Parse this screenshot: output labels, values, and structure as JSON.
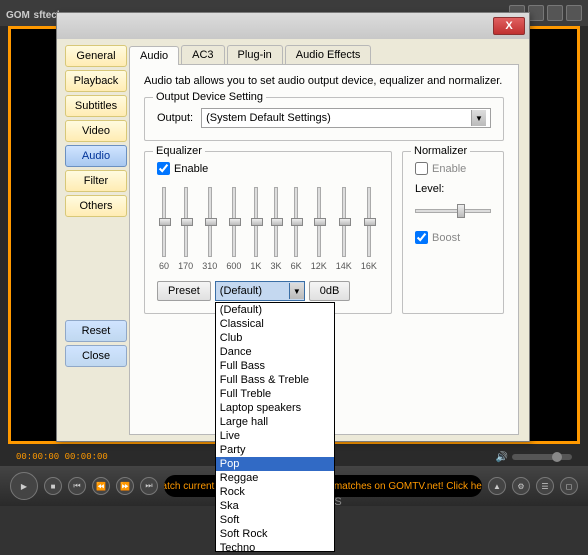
{
  "player": {
    "logo": "GOM",
    "logo_sub": "sftechs.com",
    "timecode": "00:00:00  00:00:00",
    "ticker": "Watch current Global Starcraft II League matches on GOMTV.net! Click here!",
    "preferences_label": "PREFERENCES"
  },
  "dialog": {
    "sidebar": {
      "items": [
        "General",
        "Playback",
        "Subtitles",
        "Video",
        "Audio",
        "Filter",
        "Others"
      ],
      "active_index": 4,
      "reset": "Reset",
      "close": "Close"
    },
    "tabs": [
      "Audio",
      "AC3",
      "Plug-in",
      "Audio Effects"
    ],
    "active_tab": 0,
    "hint": "Audio tab allows you to set audio output device, equalizer and normalizer.",
    "output": {
      "legend": "Output Device Setting",
      "label": "Output:",
      "value": "(System Default Settings)"
    },
    "equalizer": {
      "legend": "Equalizer",
      "enable": "Enable",
      "enable_checked": true,
      "bands": [
        "60",
        "170",
        "310",
        "600",
        "1K",
        "3K",
        "6K",
        "12K",
        "14K",
        "16K"
      ],
      "preset_btn": "Preset",
      "zero_btn": "0dB",
      "combo_value": "(Default)",
      "presets": [
        "(Default)",
        "Classical",
        "Club",
        "Dance",
        "Full Bass",
        "Full Bass & Treble",
        "Full Treble",
        "Laptop speakers",
        "Large hall",
        "Live",
        "Party",
        "Pop",
        "Reggae",
        "Rock",
        "Ska",
        "Soft",
        "Soft Rock",
        "Techno"
      ],
      "preset_highlight": 11
    },
    "normalizer": {
      "legend": "Normalizer",
      "enable": "Enable",
      "enable_checked": false,
      "level_label": "Level:",
      "boost": "Boost",
      "boost_checked": true
    }
  }
}
